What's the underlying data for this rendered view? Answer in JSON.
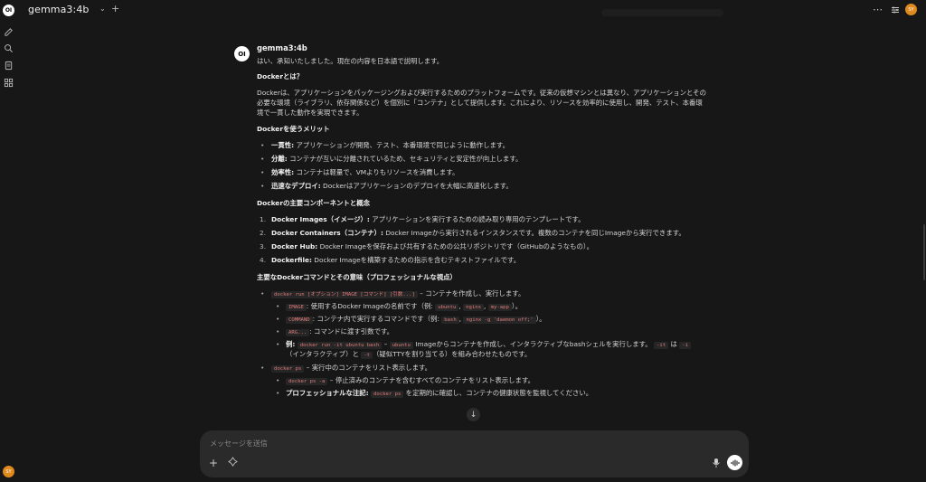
{
  "app": {
    "logo_text": "OI",
    "model_name": "gemma3:4b",
    "user_initials": "SY",
    "accent_color": "#e08a1e"
  },
  "sidebar": {
    "icons": [
      "new-chat-icon",
      "search-icon",
      "notes-icon",
      "workspace-icon"
    ]
  },
  "message": {
    "sender": "gemma3:4b",
    "intro": "はい、承知いたしました。現在の内容を日本語で説明します。",
    "what_is_heading": "Dockerとは？",
    "what_is_body": "Dockerは、アプリケーションをパッケージングおよび実行するためのプラットフォームです。従来の仮想マシンとは異なり、アプリケーションとその必要な環境（ライブラリ、依存関係など）を個別に「コンテナ」として提供します。これにより、リソースを効率的に使用し、開発、テスト、本番環境で一貫した動作を実現できます。",
    "merits_heading": "Dockerを使うメリット",
    "merits": [
      {
        "term": "一貫性:",
        "desc": " アプリケーションが開発、テスト、本番環境で同じように動作します。"
      },
      {
        "term": "分離:",
        "desc": " コンテナが互いに分離されているため、セキュリティと安定性が向上します。"
      },
      {
        "term": "効率性:",
        "desc": " コンテナは軽量で、VMよりもリソースを消費します。"
      },
      {
        "term": "迅速なデプロイ:",
        "desc": " Dockerはアプリケーションのデプロイを大幅に高速化します。"
      }
    ],
    "components_heading": "Dockerの主要コンポーネントと概念",
    "components": [
      {
        "num": "1.",
        "term": "Docker Images（イメージ）:",
        "desc": " アプリケーションを実行するための読み取り専用のテンプレートです。"
      },
      {
        "num": "2.",
        "term": "Docker Containers（コンテナ）:",
        "desc": " Docker Imageから実行されるインスタンスです。複数のコンテナを同じImageから実行できます。"
      },
      {
        "num": "3.",
        "term": "Docker Hub:",
        "desc": " Docker Imageを保存および共有するための公共リポジトリです（GitHubのようなもの）。"
      },
      {
        "num": "4.",
        "term": "Dockerfile:",
        "desc": " Docker Imageを構築するための指示を含むテキストファイルです。"
      }
    ],
    "commands_heading": "主要なDockerコマンドとその意味（プロフェッショナルな視点）",
    "cmd_run": "docker run [オプション] IMAGE [コマンド] [引数...]",
    "cmd_run_desc": " – コンテナを作成し、実行します。",
    "run_sub": {
      "image_code": "IMAGE",
      "image_desc": ": 使用するDocker Imageの名前です（例: ",
      "image_ex1": "ubuntu",
      "image_ex2": "nginx",
      "image_ex3": "my-app",
      "image_end": "）。",
      "command_code": "COMMAND",
      "command_desc": ": コンテナ内で実行するコマンドです（例: ",
      "command_ex1": "bash",
      "command_ex2": "nginx -g 'daemon off;'",
      "command_end": "）。",
      "arg_code": "ARG...",
      "arg_desc": ": コマンドに渡す引数です。",
      "ex_term": "例:",
      "ex_code1": "docker run -it ubuntu bash",
      "ex_dash": " – ",
      "ex_code2": "ubuntu",
      "ex_desc": " Imageからコンテナを作成し、インタラクティブなbashシェルを実行します。",
      "ex_code3": "-it",
      "ex_wa": " は ",
      "ex_code4": "-i",
      "ex_line2a": "（インタラクティブ）と ",
      "ex_code5": "-t",
      "ex_line2b": "（疑似TTYを割り当てる）を組み合わせたものです。"
    },
    "cmd_ps": "docker ps",
    "cmd_ps_desc": " – 実行中のコンテナをリスト表示します。",
    "ps_sub": {
      "code": "docker ps -a",
      "desc": " – 停止済みのコンテナを含むすべてのコンテナをリスト表示します。",
      "pro_term": "プロフェッショナルな注記:",
      "pro_code": "docker ps",
      "pro_desc": " を定期的に確認し、コンテナの健康状態を監視してください。"
    }
  },
  "composer": {
    "placeholder": "メッセージを送信"
  }
}
